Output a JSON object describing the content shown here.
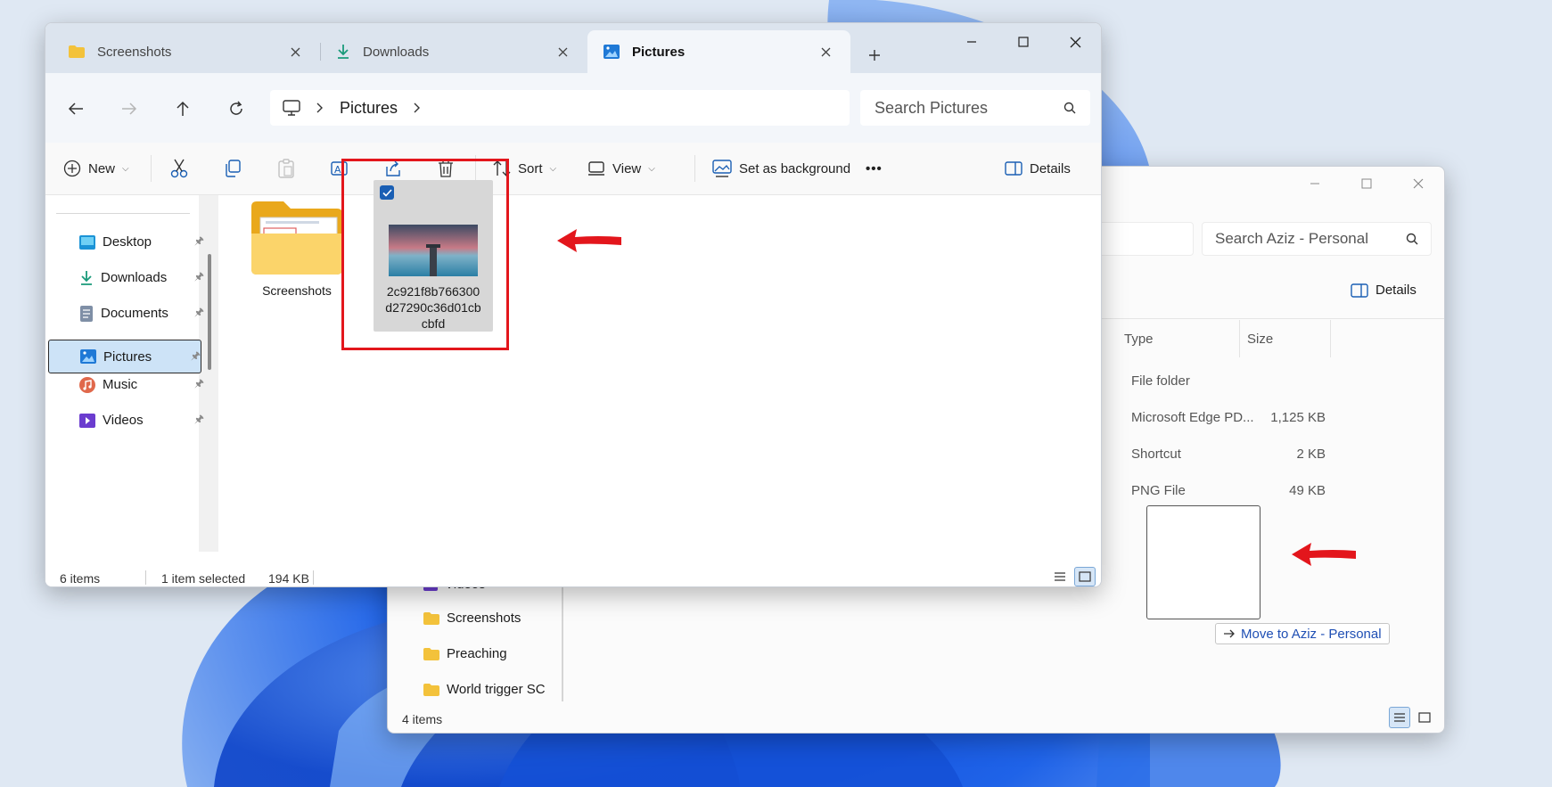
{
  "colors": {
    "accent": "#1a5fb4",
    "highlight": "#e3161c",
    "selected_nav": "#cde3f7",
    "tabbar": "#dce4ee"
  },
  "back_window": {
    "search_placeholder": "Search Aziz - Personal",
    "details_label": "Details",
    "columns": [
      "Type",
      "Size"
    ],
    "rows": [
      {
        "type": "File folder",
        "size": ""
      },
      {
        "type": "Microsoft Edge PD...",
        "size": "1,125 KB"
      },
      {
        "type": "Shortcut",
        "size": "2 KB"
      },
      {
        "type": "PNG File",
        "size": "49 KB"
      }
    ],
    "nav_items": [
      {
        "label": "Videos",
        "icon": "videos-icon"
      },
      {
        "label": "Screenshots",
        "icon": "folder-icon"
      },
      {
        "label": "Preaching",
        "icon": "folder-icon"
      },
      {
        "label": "World trigger SC",
        "icon": "folder-icon"
      }
    ],
    "status": "4 items",
    "drag_tooltip": "Move to Aziz - Personal"
  },
  "front_window": {
    "tabs": [
      {
        "label": "Screenshots",
        "icon": "folder-icon"
      },
      {
        "label": "Downloads",
        "icon": "download-icon"
      },
      {
        "label": "Pictures",
        "icon": "pictures-icon",
        "active": true
      }
    ],
    "breadcrumb": [
      "Pictures"
    ],
    "search_placeholder": "Search Pictures",
    "toolbar": {
      "new_label": "New",
      "sort_label": "Sort",
      "view_label": "View",
      "set_background_label": "Set as background",
      "more_label": "•••",
      "details_label": "Details"
    },
    "nav_items": [
      {
        "label": "Desktop",
        "icon": "desktop-icon"
      },
      {
        "label": "Downloads",
        "icon": "download-icon"
      },
      {
        "label": "Documents",
        "icon": "documents-icon"
      },
      {
        "label": "Pictures",
        "icon": "pictures-icon",
        "selected": true
      },
      {
        "label": "Music",
        "icon": "music-icon"
      },
      {
        "label": "Videos",
        "icon": "videos-icon"
      }
    ],
    "files": [
      {
        "name": "Screenshots",
        "kind": "folder"
      },
      {
        "name": "2c921f8b766300d27290c36d01cbcbfd",
        "kind": "image",
        "selected": true
      }
    ],
    "file_name_lines": [
      "2c921f8b766300",
      "d27290c36d01cb",
      "cbfd"
    ],
    "status": {
      "count": "6 items",
      "selection": "1 item selected",
      "size": "194 KB"
    }
  }
}
